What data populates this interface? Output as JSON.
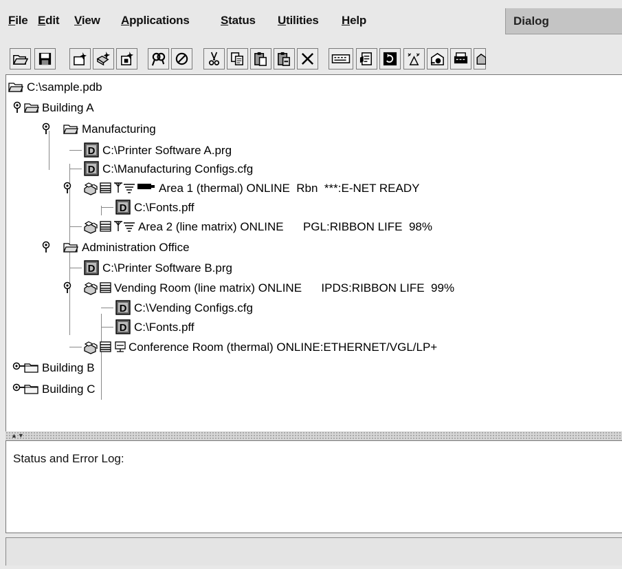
{
  "menu": [
    {
      "label": "File",
      "mnemonic": "F",
      "rest": "ile"
    },
    {
      "label": "Edit",
      "mnemonic": "E",
      "rest": "dit"
    },
    {
      "label": "View",
      "mnemonic": "V",
      "rest": "iew"
    },
    {
      "label": "Applications",
      "mnemonic": "A",
      "rest": "pplications"
    },
    {
      "label": "Status",
      "mnemonic": "S",
      "rest": "tatus"
    },
    {
      "label": "Utilities",
      "mnemonic": "U",
      "rest": "tilities"
    },
    {
      "label": "Help",
      "mnemonic": "H",
      "rest": "elp"
    }
  ],
  "dialog_label": "Dialog",
  "toolbar": [
    "open-icon",
    "save-icon",
    "new-printer-icon",
    "new-group-icon",
    "new-app-icon",
    "find-icon",
    "stop-icon",
    "cut-icon",
    "copy-icon",
    "paste-icon",
    "paste-special-icon",
    "delete-icon",
    "panel-icon",
    "properties-icon",
    "refresh-icon",
    "tools-icon",
    "configure-icon",
    "monitor-icon",
    "printer-status-icon"
  ],
  "tree": {
    "root": "C:\\sample.pdb",
    "building_a": "Building A",
    "manufacturing": "Manufacturing",
    "mfg_software": "C:\\Printer Software A.prg",
    "mfg_configs": "C:\\Manufacturing Configs.cfg",
    "area1": "Area 1 (thermal) ONLINE  Rbn  ***:E-NET READY",
    "area1_fonts": "C:\\Fonts.pff",
    "area2": "Area 2 (line matrix) ONLINE      PGL:RIBBON LIFE  98%",
    "admin": "Administration Office",
    "admin_software": "C:\\Printer Software B.prg",
    "vending": "Vending Room (line matrix) ONLINE      IPDS:RIBBON LIFE  99%",
    "vending_configs": "C:\\Vending Configs.cfg",
    "vending_fonts": "C:\\Fonts.pff",
    "conference": "Conference Room (thermal) ONLINE:ETHERNET/VGL/LP+",
    "building_b": "Building B",
    "building_c": "Building C"
  },
  "log": {
    "label": "Status and Error Log:"
  }
}
